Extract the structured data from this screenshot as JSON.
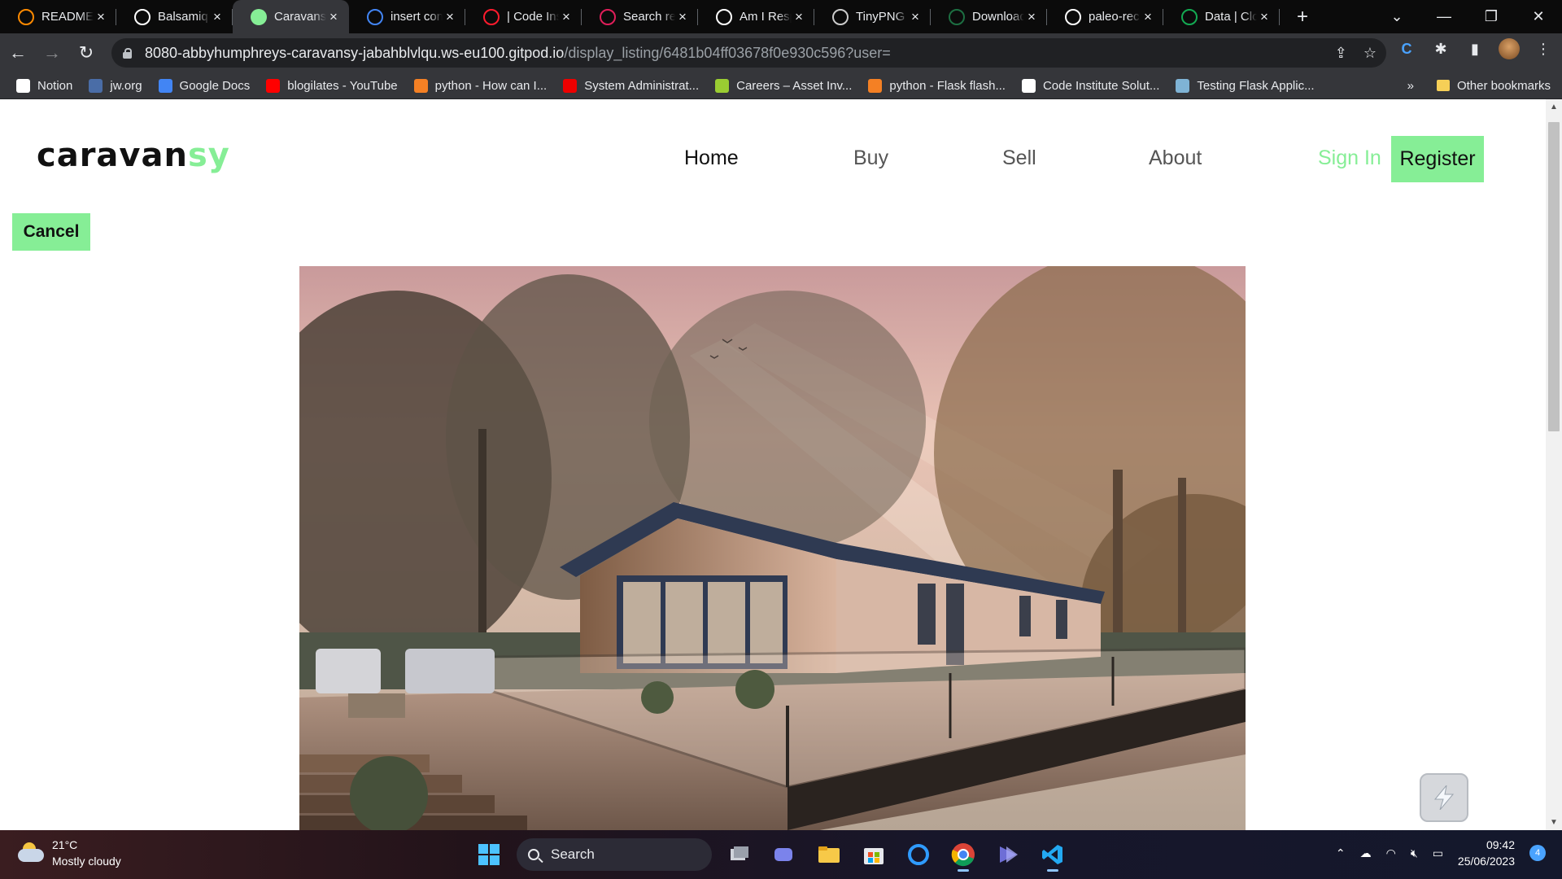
{
  "browser": {
    "tabs": [
      {
        "title": "README",
        "favicon": "gitpod-icon",
        "color": "#ff8a00",
        "active": false
      },
      {
        "title": "Balsamiq",
        "favicon": "balsamiq-icon",
        "color": "#ffffff",
        "active": false
      },
      {
        "title": "Caravansy",
        "favicon": "caravansy-icon",
        "color": "#86ee96",
        "active": true
      },
      {
        "title": "insert cont",
        "favicon": "google-icon",
        "color": "#4285f4",
        "active": false
      },
      {
        "title": "| Code Ins",
        "favicon": "opera-icon",
        "color": "#ff1b2d",
        "active": false
      },
      {
        "title": "Search re",
        "favicon": "slack-icon",
        "color": "#e01e5a",
        "active": false
      },
      {
        "title": "Am I Resp",
        "favicon": "t-icon",
        "color": "#ffffff",
        "active": false
      },
      {
        "title": "TinyPNG",
        "favicon": "tinypng-icon",
        "color": "#cccccc",
        "active": false
      },
      {
        "title": "Download",
        "favicon": "excel-icon",
        "color": "#1d6f42",
        "active": false
      },
      {
        "title": "paleo-rec",
        "favicon": "github-icon",
        "color": "#ffffff",
        "active": false
      },
      {
        "title": "Data | Clo",
        "favicon": "mongodb-icon",
        "color": "#13aa52",
        "active": false
      }
    ],
    "url_host": "8080-abbyhumphreys-caravansy-jabahblvlqu.ws-eu100.gitpod.io",
    "url_path": "/display_listing/6481b04ff03678f0e930c596?user=",
    "bookmarks": [
      {
        "label": "Notion",
        "icon": "notion-icon",
        "color": "#ffffff"
      },
      {
        "label": "jw.org",
        "icon": "jw-icon",
        "color": "#4a6da7"
      },
      {
        "label": "Google Docs",
        "icon": "docs-icon",
        "color": "#4285f4"
      },
      {
        "label": "blogilates - YouTube",
        "icon": "youtube-icon",
        "color": "#ff0000"
      },
      {
        "label": "python - How can I...",
        "icon": "stackoverflow-icon",
        "color": "#f48024"
      },
      {
        "label": "System Administrat...",
        "icon": "redhat-icon",
        "color": "#ee0000"
      },
      {
        "label": "Careers – Asset Inv...",
        "icon": "careers-icon",
        "color": "#9acd32"
      },
      {
        "label": "python - Flask flash...",
        "icon": "stackoverflow-icon",
        "color": "#f48024"
      },
      {
        "label": "Code Institute Solut...",
        "icon": "github-icon",
        "color": "#ffffff"
      },
      {
        "label": "Testing Flask Applic...",
        "icon": "flask-icon",
        "color": "#7fb3d5"
      }
    ],
    "bookmarks_overflow": "»",
    "other_bookmarks": "Other bookmarks"
  },
  "site": {
    "logo_main": "caravan",
    "logo_accent": "sy",
    "nav": {
      "home": "Home",
      "buy": "Buy",
      "sell": "Sell",
      "about": "About"
    },
    "sign_in": "Sign In",
    "register": "Register",
    "cancel": "Cancel",
    "accent_color": "#86ee96"
  },
  "taskbar": {
    "temperature": "21°C",
    "weather": "Mostly cloudy",
    "search": "Search",
    "time": "09:42",
    "date": "25/06/2023",
    "notifications": "4"
  }
}
